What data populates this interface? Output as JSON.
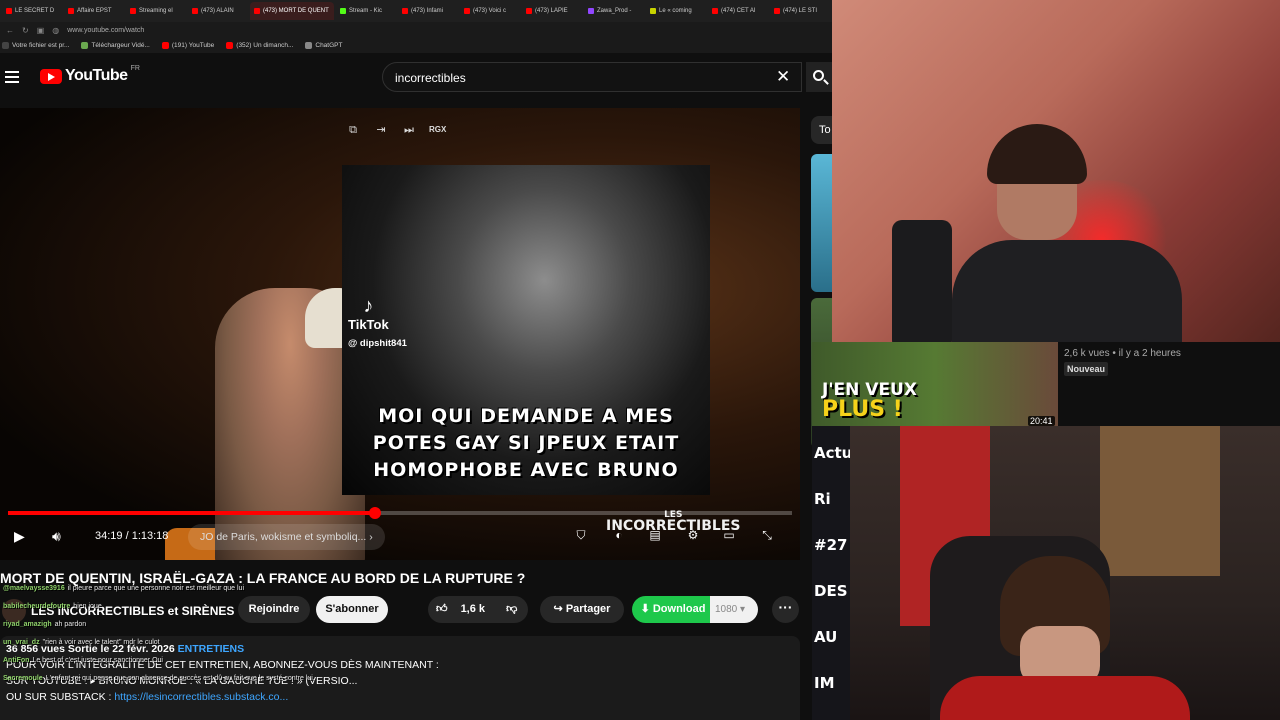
{
  "browser": {
    "tabs": [
      {
        "label": "LE SECRET D",
        "color": "#ff0000"
      },
      {
        "label": "Affaire EPST",
        "color": "#ff0000"
      },
      {
        "label": "Streaming el",
        "color": "#ff0000"
      },
      {
        "label": "(473) ALAIN",
        "color": "#ff0000"
      },
      {
        "label": "(473) MORT DE QUENT",
        "color": "#ff0000",
        "active": true
      },
      {
        "label": "Stream - Kic",
        "color": "#53fc18"
      },
      {
        "label": "(473) Infami",
        "color": "#ff0000"
      },
      {
        "label": "(473) Voici c",
        "color": "#ff0000"
      },
      {
        "label": "(473) LAPIE",
        "color": "#ff0000"
      },
      {
        "label": "Zawa_Prod -",
        "color": "#9146ff"
      },
      {
        "label": "Le « coming",
        "color": "#c8d400"
      },
      {
        "label": "(474) CET AI",
        "color": "#ff0000"
      },
      {
        "label": "(474) LE STI",
        "color": "#ff0000"
      }
    ],
    "url": "www.youtube.com/watch",
    "bookmarks": [
      {
        "label": "Votre fichier est pr...",
        "color": "#444"
      },
      {
        "label": "Téléchargeur Vidé...",
        "color": "#6aa84f"
      },
      {
        "label": "(191) YouTube",
        "color": "#ff0000"
      },
      {
        "label": "(352) Un dimanch...",
        "color": "#ff0000"
      },
      {
        "label": "ChatGPT",
        "color": "#888"
      }
    ]
  },
  "youtube": {
    "logo_word": "YouTube",
    "country": "FR",
    "search_query": "incorrectibles"
  },
  "player": {
    "tools_label": "RGX",
    "tiktok_brand": "TikTok",
    "tiktok_user": "@ dipshit841",
    "meme_lines": [
      "MOI QUI DEMANDE A MES",
      "POTES GAY SI JPEUX ETAIT",
      "HOMOPHOBE AVEC BRUNO"
    ],
    "brand_small": "LES",
    "brand_big": "INCORRECTIBLES",
    "time": "34:19 / 1:13:18",
    "chapter": "JO de Paris, wokisme et symboliq...",
    "progress": 0.468
  },
  "video": {
    "title": "MORT DE QUENTIN, ISRAËL-GAZA : LA FRANCE AU BORD DE LA RUPTURE ?",
    "channel": "LES INCORRECTIBLES et SIRÈNES",
    "join_label": "Rejoindre",
    "subscribe_label": "S'abonner",
    "likes": "1,6 k",
    "share_label": "Partager",
    "download_label": "Download",
    "download_res": "1080",
    "desc_stats": "36 856 vues  Sortie le 22 févr. 2026",
    "desc_tag": "ENTRETIENS",
    "desc_line2": "POUR VOIR L'INTÉGRALITÉ DE CET ENTRETIEN, ABONNEZ-VOUS DÈS MAINTENANT :",
    "desc_line3": "SUR YOUTUBE : ▸ BRUNO MONROE : « LA GAUCHE TUE ! » (VERSIO...",
    "desc_line4_prefix": "OU SUR SUBSTACK : ",
    "desc_link": "https://lesincorrectibles.substack.co..."
  },
  "chat": [
    {
      "user": "@maelvaysse3916",
      "msg": "il pleure parce que une personne noir est meilleur que lui"
    },
    {
      "user": "babilecheurdefoutre",
      "msg": "bien joue"
    },
    {
      "user": "riyad_amazigh",
      "msg": "ah pardon"
    },
    {
      "user": "un_vrai_dz",
      "msg": "\"rien à voir avec le talent\" mdr le culot"
    },
    {
      "user": "AntiFon",
      "msg": "Le best of c'est juste pour sanctionner Oui"
    },
    {
      "user": "Sacremoule",
      "msg": "L'enfant roi qui pense que son absence de succès est dû au fait que le systé contre lui."
    }
  ],
  "sidebar": {
    "chip": "To"
  },
  "recommended": {
    "views": "2,6 k vues • il y a 2 heures",
    "badge": "Nouveau",
    "thumb_line1": "J'EN VEUX",
    "thumb_line2": "PLUS !",
    "duration": "20:41"
  },
  "left_strip": [
    "Actu",
    "Ri",
    "#27",
    "DES",
    "AU",
    "IM"
  ]
}
